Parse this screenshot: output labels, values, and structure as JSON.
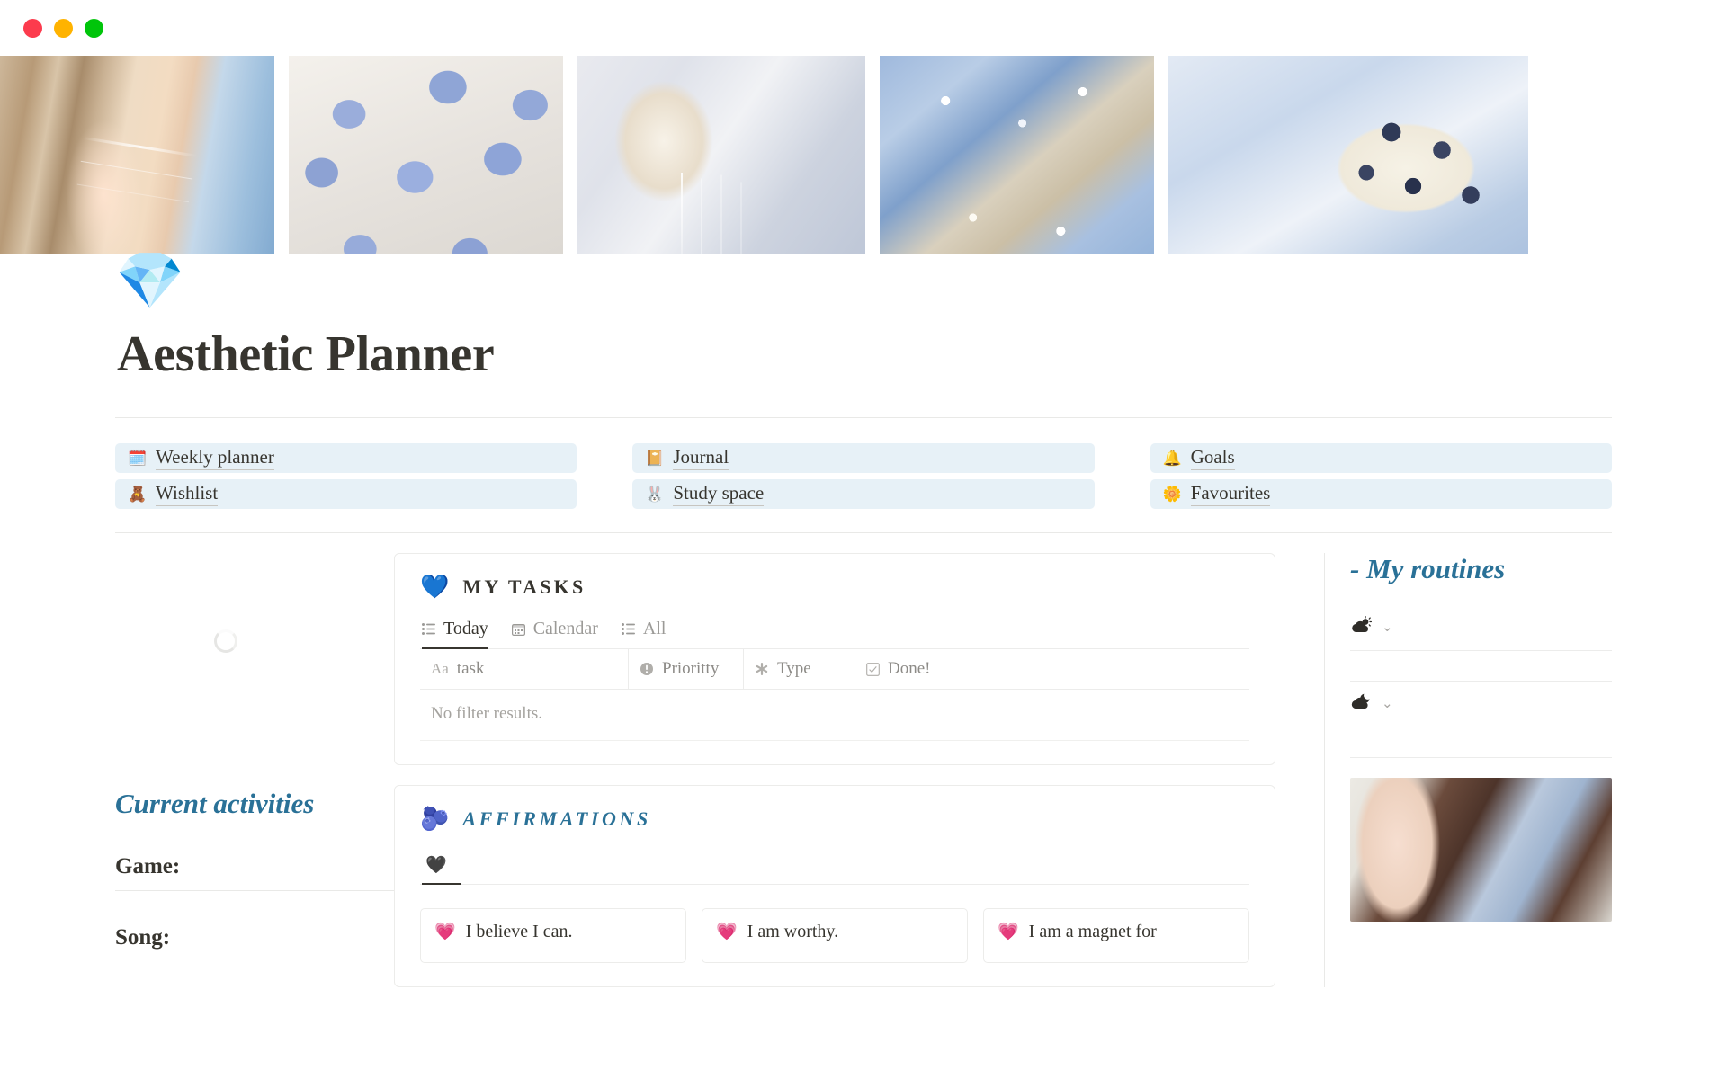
{
  "window": {
    "controls": [
      "close",
      "minimize",
      "maximize"
    ]
  },
  "cover": {
    "images": [
      {
        "alt": "blonde woman wearing heart locket necklace and blue cardigan"
      },
      {
        "alt": "periwinkle blue heart shaped candles"
      },
      {
        "alt": "beaded necklace draped over a white shell on silk"
      },
      {
        "alt": "blue floral claw hair clips"
      },
      {
        "alt": "blueberry cream cake slice on a speckled blue plate"
      }
    ]
  },
  "header": {
    "icon": "gem-stone-icon",
    "icon_glyph": "💎",
    "title": "Aesthetic Planner"
  },
  "nav": {
    "columns": [
      {
        "links": [
          {
            "icon": "calendar-icon",
            "glyph": "🗓️",
            "label": "Weekly planner"
          },
          {
            "icon": "teddy-bear-icon",
            "glyph": "🧸",
            "label": "Wishlist"
          }
        ]
      },
      {
        "links": [
          {
            "icon": "notebook-icon",
            "glyph": "📔",
            "label": "Journal"
          },
          {
            "icon": "cloud-character-icon",
            "glyph": "🐰",
            "label": "Study space"
          }
        ]
      },
      {
        "links": [
          {
            "icon": "dark-bell-icon",
            "glyph": "🔔",
            "label": "Goals"
          },
          {
            "icon": "flower-icon",
            "glyph": "🌼",
            "label": "Favourites"
          }
        ]
      }
    ]
  },
  "tasks_card": {
    "icon": "blue-heart-icon",
    "icon_glyph": "💙",
    "title": "MY TASKS",
    "tabs": [
      {
        "icon": "list-icon",
        "label": "Today",
        "active": true
      },
      {
        "icon": "calendar-icon",
        "label": "Calendar",
        "active": false
      },
      {
        "icon": "list-icon",
        "label": "All",
        "active": false
      }
    ],
    "columns": [
      {
        "icon": "text-type-icon",
        "icon_glyph": "Aa",
        "label": "task"
      },
      {
        "icon": "exclamation-circle-icon",
        "label": "Prioritty"
      },
      {
        "icon": "asterisk-icon",
        "label": "Type"
      },
      {
        "icon": "checkbox-icon",
        "label": "Done!"
      }
    ],
    "empty_message": "No filter results."
  },
  "affirmations_card": {
    "icon": "blueberries-icon",
    "icon_glyph": "🫐",
    "title": "AFFIRMATIONS",
    "tab": {
      "icon": "black-heart-icon",
      "glyph": "🖤"
    },
    "items": [
      {
        "icon": "growing-heart-icon",
        "glyph": "💗",
        "text": "I believe I can."
      },
      {
        "icon": "growing-heart-icon",
        "glyph": "💗",
        "text": "I am worthy."
      },
      {
        "icon": "growing-heart-icon",
        "glyph": "💗",
        "text": "I am a magnet for"
      }
    ]
  },
  "current_activities": {
    "title": "Current activities",
    "fields": [
      {
        "label": "Game:"
      },
      {
        "label": "Song:"
      }
    ]
  },
  "routines": {
    "title": "- My routines",
    "items": [
      {
        "icon": "sun-behind-cloud-icon",
        "glyph": "⛅",
        "chevron": "⌄"
      },
      {
        "icon": "moon-behind-cloud-icon",
        "glyph": "🌒",
        "chevron": "⌄"
      }
    ],
    "photo": {
      "alt": "woman with long dark hair wearing a blue checked shirt"
    }
  },
  "colors": {
    "accent_teal": "#2a7197",
    "link_background": "#e7f1f7",
    "text": "#37352f",
    "muted": "#9b9a97",
    "border": "#e9e9e7"
  }
}
